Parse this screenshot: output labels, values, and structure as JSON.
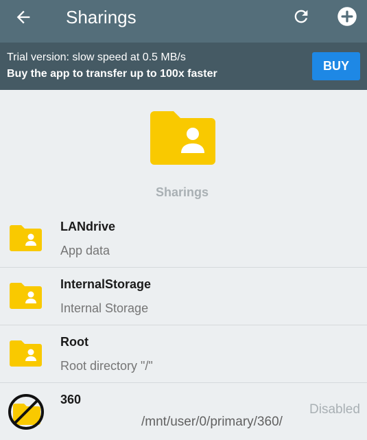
{
  "appbar": {
    "title": "Sharings",
    "back_icon": "back-arrow-icon",
    "refresh_icon": "refresh-icon",
    "add_icon": "add-circle-icon"
  },
  "trial_banner": {
    "line1": "Trial version: slow speed at 0.5 MB/s",
    "line2": "Buy the app to transfer up to 100x faster",
    "buy_label": "BUY"
  },
  "hero": {
    "icon": "shared-folder-icon",
    "label": "Sharings"
  },
  "sharings": [
    {
      "name": "LANdrive",
      "subtitle": "App data",
      "icon": "shared-folder-icon"
    },
    {
      "name": "InternalStorage",
      "subtitle": "Internal Storage",
      "icon": "shared-folder-icon"
    },
    {
      "name": "Root",
      "subtitle": "Root directory \"/\"",
      "icon": "shared-folder-icon"
    },
    {
      "name": "360",
      "subtitle": "/mnt/user/0/primary/360/",
      "status": "Disabled",
      "icon": "disabled-folder-icon"
    }
  ],
  "colors": {
    "appbar": "#546e7a",
    "banner": "#455a64",
    "buy_button": "#1e88e5",
    "folder": "#f9c900",
    "background": "#eceff1"
  }
}
